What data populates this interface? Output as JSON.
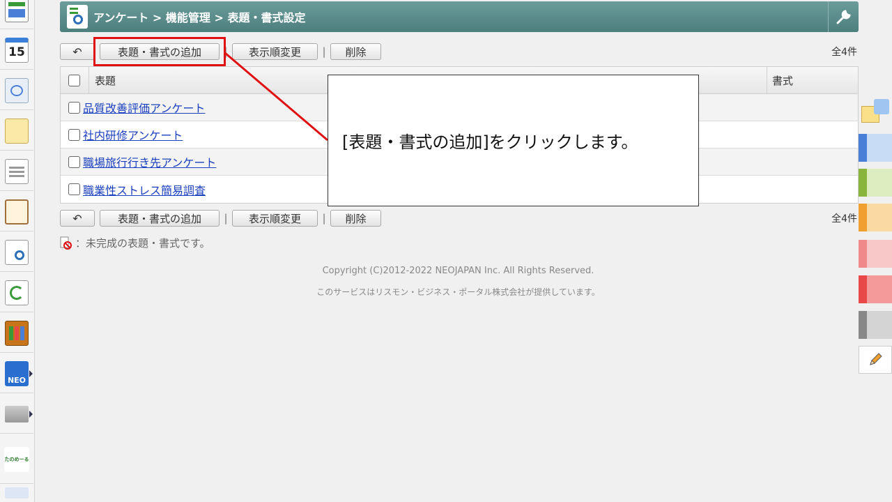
{
  "header": {
    "breadcrumb": "アンケート > 機能管理 > 表題・書式設定",
    "tool_icon": "wrench-icon"
  },
  "toolbar": {
    "back_icon": "↶",
    "add_label": "表題・書式の追加",
    "order_label": "表示順変更",
    "delete_label": "削除",
    "separator": "|",
    "count": "全4件"
  },
  "table": {
    "headers": {
      "title": "表題",
      "format": "書式"
    },
    "rows": [
      {
        "title": "品質改善評価アンケート",
        "format": ""
      },
      {
        "title": "社内研修アンケート",
        "format": ""
      },
      {
        "title": "職場旅行行き先アンケート",
        "format": ""
      },
      {
        "title": "職業性ストレス簡易調査",
        "format": ""
      }
    ]
  },
  "note": "：未完成の表題・書式です。",
  "footer": {
    "copyright": "Copyright (C)2012-2022 NEOJAPAN Inc. All Rights Reserved.",
    "provider": "このサービスはリスモン・ビジネス・ポータル株式会社が提供しています。"
  },
  "callout": {
    "text": "[表題・書式の追加]をクリックします。"
  },
  "sidebar": {
    "calendar_day": "15",
    "neo_label": "NEO",
    "tanomu_label": "たのめーる"
  },
  "colors": {
    "header": "#5a8c8b",
    "link": "#1a3fbf",
    "highlight": "#e01010",
    "palette": [
      "#4a7fd8",
      "#8ab53c",
      "#f0a030",
      "#f08a8a",
      "#e84848",
      "#888888"
    ]
  }
}
